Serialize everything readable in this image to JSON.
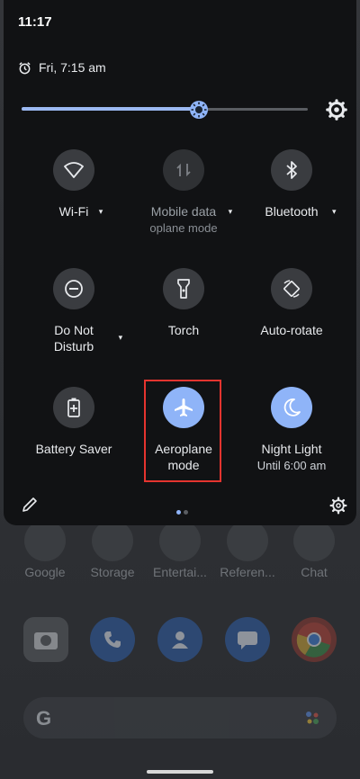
{
  "status_bar": {
    "time": "11:17"
  },
  "alarm": {
    "text": "Fri, 7:15 am",
    "icon": "alarm-clock-icon"
  },
  "brightness": {
    "level": 0.62
  },
  "tiles": {
    "wifi": {
      "label": "Wi-Fi",
      "icon": "wifi-icon",
      "has_menu": true
    },
    "mobile_data": {
      "label": "Mobile data",
      "sublabel": "oplane mode",
      "icon": "mobile-data-icon",
      "has_menu": true
    },
    "bluetooth": {
      "label": "Bluetooth",
      "icon": "bluetooth-icon",
      "has_menu": true
    },
    "dnd": {
      "label_line1": "Do Not",
      "label_line2": "Disturb",
      "icon": "do-not-disturb-icon",
      "has_menu": true
    },
    "torch": {
      "label": "Torch",
      "icon": "torch-icon"
    },
    "auto_rotate": {
      "label": "Auto-rotate",
      "icon": "auto-rotate-icon"
    },
    "battery_saver": {
      "label": "Battery Saver",
      "icon": "battery-saver-icon"
    },
    "aeroplane": {
      "label_line1": "Aeroplane",
      "label_line2": "mode",
      "icon": "airplane-icon",
      "state": "on"
    },
    "night_light": {
      "label": "Night Light",
      "sublabel": "Until 6:00 am",
      "icon": "moon-icon",
      "state": "on"
    }
  },
  "menu_caret": "▾",
  "home_apps": [
    {
      "label": "Google"
    },
    {
      "label": "Storage"
    },
    {
      "label": "Entertai..."
    },
    {
      "label": "Referen..."
    },
    {
      "label": "Chat"
    }
  ],
  "search": {
    "logo": "G"
  },
  "colors": {
    "accent": "#8fb4f8",
    "highlight_box": "#e5342f",
    "shade_bg": "#111214"
  }
}
